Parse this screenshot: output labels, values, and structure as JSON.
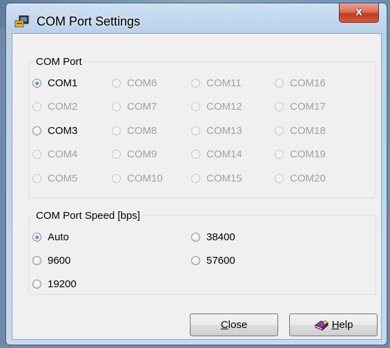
{
  "window": {
    "title": "COM Port Settings",
    "close_glyph": "x",
    "icon": "com-port-app-icon"
  },
  "com_port_group": {
    "label": "COM Port",
    "selected": "COM1",
    "options": [
      {
        "label": "COM1",
        "enabled": true,
        "checked": true
      },
      {
        "label": "COM2",
        "enabled": false,
        "checked": false
      },
      {
        "label": "COM3",
        "enabled": true,
        "checked": false
      },
      {
        "label": "COM4",
        "enabled": false,
        "checked": false
      },
      {
        "label": "COM5",
        "enabled": false,
        "checked": false
      },
      {
        "label": "COM6",
        "enabled": false,
        "checked": false
      },
      {
        "label": "COM7",
        "enabled": false,
        "checked": false
      },
      {
        "label": "COM8",
        "enabled": false,
        "checked": false
      },
      {
        "label": "COM9",
        "enabled": false,
        "checked": false
      },
      {
        "label": "COM10",
        "enabled": false,
        "checked": false
      },
      {
        "label": "COM11",
        "enabled": false,
        "checked": false
      },
      {
        "label": "COM12",
        "enabled": false,
        "checked": false
      },
      {
        "label": "COM13",
        "enabled": false,
        "checked": false
      },
      {
        "label": "COM14",
        "enabled": false,
        "checked": false
      },
      {
        "label": "COM15",
        "enabled": false,
        "checked": false
      },
      {
        "label": "COM16",
        "enabled": false,
        "checked": false
      },
      {
        "label": "COM17",
        "enabled": false,
        "checked": false
      },
      {
        "label": "COM18",
        "enabled": false,
        "checked": false
      },
      {
        "label": "COM19",
        "enabled": false,
        "checked": false
      },
      {
        "label": "COM20",
        "enabled": false,
        "checked": false
      }
    ]
  },
  "speed_group": {
    "label": "COM Port Speed [bps]",
    "selected": "Auto",
    "options": [
      {
        "label": "Auto",
        "checked": true
      },
      {
        "label": "9600",
        "checked": false
      },
      {
        "label": "19200",
        "checked": false
      },
      {
        "label": "38400",
        "checked": false
      },
      {
        "label": "57600",
        "checked": false
      }
    ]
  },
  "buttons": {
    "close": {
      "mnemonic": "C",
      "rest": "lose"
    },
    "help": {
      "mnemonic": "H",
      "rest": "elp",
      "icon": "help-book-icon"
    }
  },
  "colors": {
    "selected_radio": "#1c5fb0",
    "close_button": "#c23b22",
    "disabled_text": "#a0a0a0"
  }
}
